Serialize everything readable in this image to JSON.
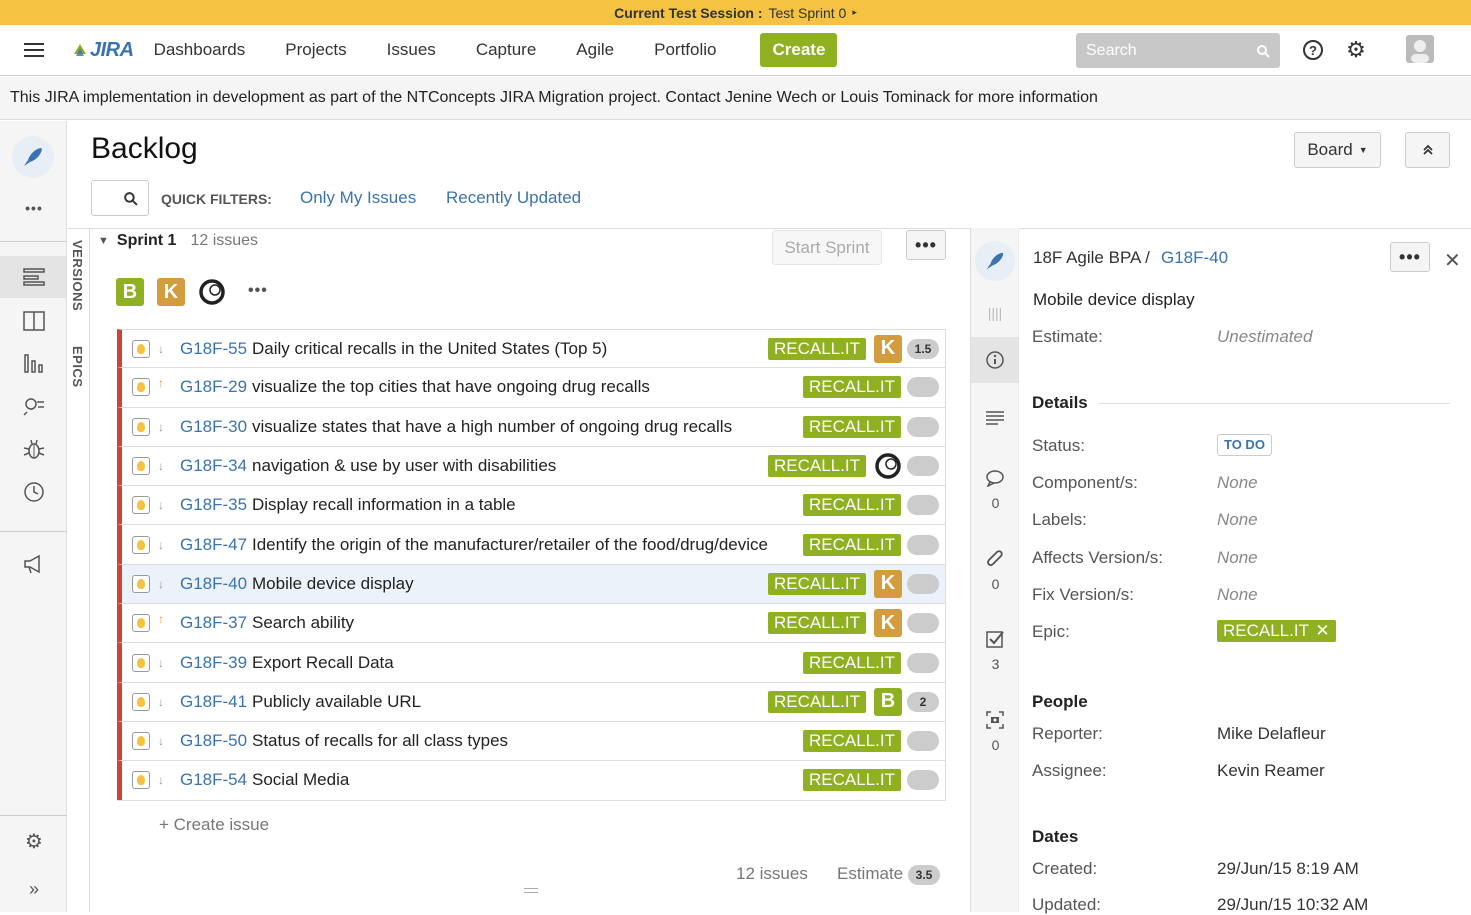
{
  "session": {
    "label": "Current Test Session :",
    "value": "Test Sprint 0"
  },
  "nav": {
    "logo": "JIRA",
    "items": [
      "Dashboards",
      "Projects",
      "Issues",
      "Capture",
      "Agile",
      "Portfolio"
    ],
    "create": "Create",
    "search_placeholder": "Search"
  },
  "banner": "This JIRA implementation in development as part of the NTConcepts JIRA Migration project. Contact Jenine Wech or Louis Tominack for more information",
  "page": {
    "title": "Backlog",
    "board_btn": "Board",
    "quick_filters_label": "QUICK FILTERS:",
    "filters": [
      "Only My Issues",
      "Recently Updated"
    ],
    "vtabs": [
      "VERSIONS",
      "EPICS"
    ]
  },
  "sprint": {
    "name": "Sprint 1",
    "count": "12 issues",
    "start_btn": "Start Sprint",
    "assignee_badges": [
      "B",
      "K"
    ],
    "issues": [
      {
        "key": "G18F-55",
        "summary": "Daily critical recalls in the United States (Top 5)",
        "epic": "RECALL.IT",
        "assignee": "K",
        "estimate": "1.5",
        "priority": "down"
      },
      {
        "key": "G18F-29",
        "summary": "visualize the top cities that have ongoing drug recalls",
        "epic": "RECALL.IT",
        "assignee": "",
        "estimate": "",
        "priority": "up"
      },
      {
        "key": "G18F-30",
        "summary": "visualize states that have a high number of ongoing drug recalls",
        "epic": "RECALL.IT",
        "assignee": "",
        "estimate": "",
        "priority": "down"
      },
      {
        "key": "G18F-34",
        "summary": "navigation & use by user with disabilities",
        "epic": "RECALL.IT",
        "assignee": "sync",
        "estimate": "",
        "priority": "down"
      },
      {
        "key": "G18F-35",
        "summary": "Display recall information in a table",
        "epic": "RECALL.IT",
        "assignee": "",
        "estimate": "",
        "priority": "down"
      },
      {
        "key": "G18F-47",
        "summary": "Identify the origin of the manufacturer/retailer of the food/drug/device",
        "epic": "RECALL.IT",
        "assignee": "",
        "estimate": "",
        "priority": "down"
      },
      {
        "key": "G18F-40",
        "summary": "Mobile device display",
        "epic": "RECALL.IT",
        "assignee": "K",
        "estimate": "",
        "priority": "down"
      },
      {
        "key": "G18F-37",
        "summary": "Search ability",
        "epic": "RECALL.IT",
        "assignee": "K",
        "estimate": "",
        "priority": "up"
      },
      {
        "key": "G18F-39",
        "summary": "Export Recall Data",
        "epic": "RECALL.IT",
        "assignee": "",
        "estimate": "",
        "priority": "down"
      },
      {
        "key": "G18F-41",
        "summary": "Publicly available URL",
        "epic": "RECALL.IT",
        "assignee": "B",
        "estimate": "2",
        "priority": "down"
      },
      {
        "key": "G18F-50",
        "summary": "Status of recalls for all class types",
        "epic": "RECALL.IT",
        "assignee": "",
        "estimate": "",
        "priority": "down"
      },
      {
        "key": "G18F-54",
        "summary": "Social Media",
        "epic": "RECALL.IT",
        "assignee": "",
        "estimate": "",
        "priority": "down"
      }
    ],
    "create_issue": "+   Create issue",
    "footer_count": "12 issues",
    "footer_estimate_label": "Estimate",
    "footer_estimate": "3.5"
  },
  "detail": {
    "project": "18F Agile BPA /",
    "key": "G18F-40",
    "summary": "Mobile device display",
    "estimate_label": "Estimate:",
    "estimate_value": "Unestimated",
    "details_head": "Details",
    "status_label": "Status:",
    "status_value": "TO DO",
    "components_label": "Component/s:",
    "components_value": "None",
    "labels_label": "Labels:",
    "labels_value": "None",
    "affects_label": "Affects Version/s:",
    "affects_value": "None",
    "fix_label": "Fix Version/s:",
    "fix_value": "None",
    "epic_label": "Epic:",
    "epic_value": "RECALL.IT",
    "people_head": "People",
    "reporter_label": "Reporter:",
    "reporter_value": "Mike Delafleur",
    "assignee_label": "Assignee:",
    "assignee_value": "Kevin Reamer",
    "dates_head": "Dates",
    "created_label": "Created:",
    "created_value": "29/Jun/15 8:19 AM",
    "updated_label": "Updated:",
    "updated_value": "29/Jun/15 10:32 AM",
    "side_counts": [
      "0",
      "0",
      "3",
      "0"
    ]
  },
  "colors": {
    "session_bar": "#f5c242",
    "create": "#8eb021",
    "epic": "#8eb021",
    "badge_k": "#d39c3f",
    "badge_b": "#8eb021",
    "link": "#3b73af",
    "issue_border": "#d04437"
  }
}
